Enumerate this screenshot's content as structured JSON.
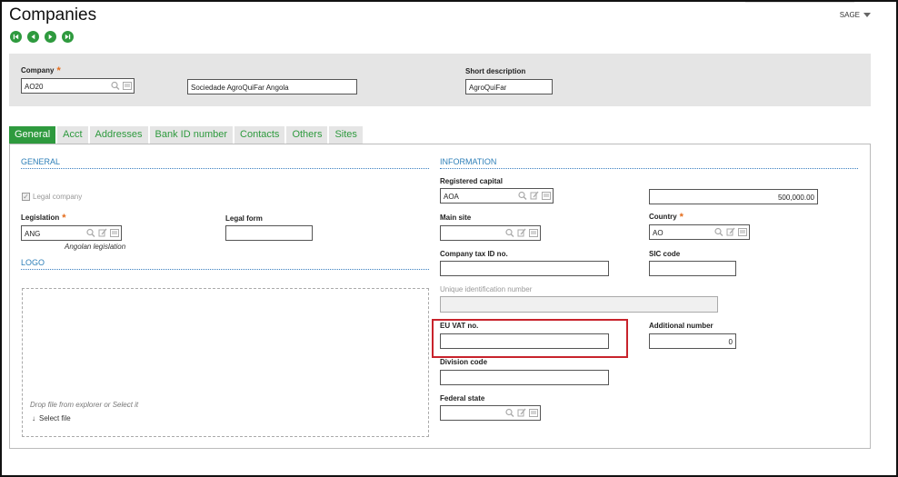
{
  "page": {
    "title": "Companies",
    "user_menu": "SAGE"
  },
  "nav": {
    "first": "first-record",
    "previous": "previous-record",
    "next": "next-record",
    "last": "last-record"
  },
  "header": {
    "company_label": "Company",
    "company_value": "AO20",
    "company_name_value": "Sociedade AgroQuiFar Angola",
    "short_description_label": "Short description",
    "short_description_value": "AgroQuiFar"
  },
  "tabs": [
    "General",
    "Acct",
    "Addresses",
    "Bank ID number",
    "Contacts",
    "Others",
    "Sites"
  ],
  "general": {
    "section_title": "GENERAL",
    "legal_company_label": "Legal company",
    "legal_company_checked": true,
    "legislation_label": "Legislation",
    "legislation_value": "ANG",
    "legislation_note": "Angolan legislation",
    "legal_form_label": "Legal form",
    "legal_form_value": ""
  },
  "logo": {
    "section_title": "LOGO",
    "drop_hint": "Drop file from explorer or Select it",
    "select_file_label": "Select file"
  },
  "information": {
    "section_title": "INFORMATION",
    "registered_capital_label": "Registered capital",
    "registered_capital_currency": "AOA",
    "registered_capital_amount": "500,000.00",
    "main_site_label": "Main site",
    "main_site_value": "",
    "country_label": "Country",
    "country_value": "AO",
    "company_tax_id_label": "Company tax ID no.",
    "company_tax_id_value": "",
    "sic_code_label": "SIC code",
    "sic_code_value": "",
    "unique_id_label": "Unique identification number",
    "unique_id_value": "",
    "eu_vat_label": "EU VAT no.",
    "eu_vat_value": "",
    "additional_number_label": "Additional number",
    "additional_number_value": "0",
    "division_code_label": "Division code",
    "division_code_value": "",
    "federal_state_label": "Federal state",
    "federal_state_value": ""
  },
  "colors": {
    "accent_green": "#2e9a3e",
    "section_blue": "#2e7fb8",
    "required_orange": "#e46c1b",
    "highlight_red": "#c8232c",
    "panel_gray": "#e5e5e5"
  }
}
